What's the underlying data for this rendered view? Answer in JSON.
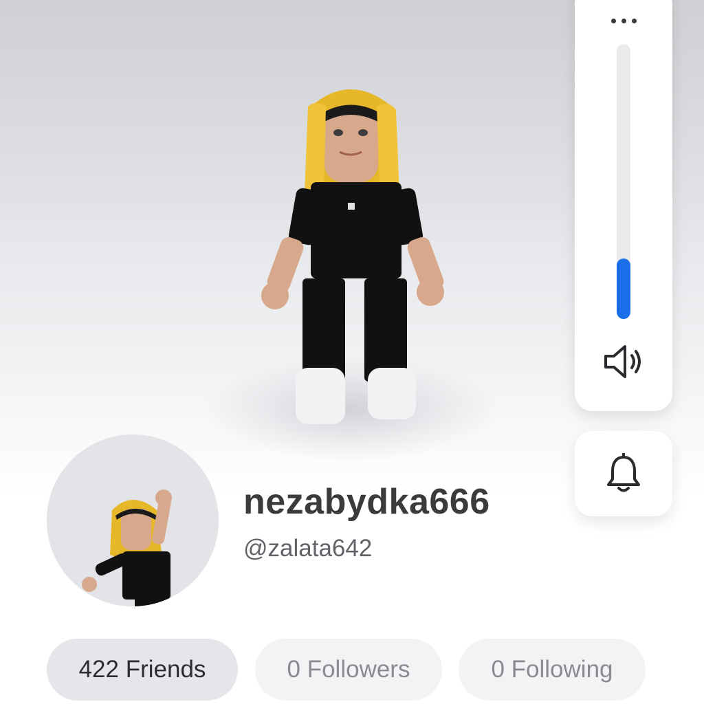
{
  "profile": {
    "display_name": "nezabydka666",
    "username": "@zalata642"
  },
  "stats": {
    "friends": "422 Friends",
    "followers": "0 Followers",
    "following": "0 Following"
  },
  "controls": {
    "more_icon": "more-horizontal-icon",
    "speaker_icon": "speaker-icon",
    "bell_icon": "bell-icon",
    "volume_level": 0.22
  },
  "colors": {
    "accent": "#1a6fe8",
    "text_primary": "#393b3d",
    "text_secondary": "#606268",
    "pill_active": "#e6e6ea",
    "pill_inactive": "#f4f2f5"
  }
}
